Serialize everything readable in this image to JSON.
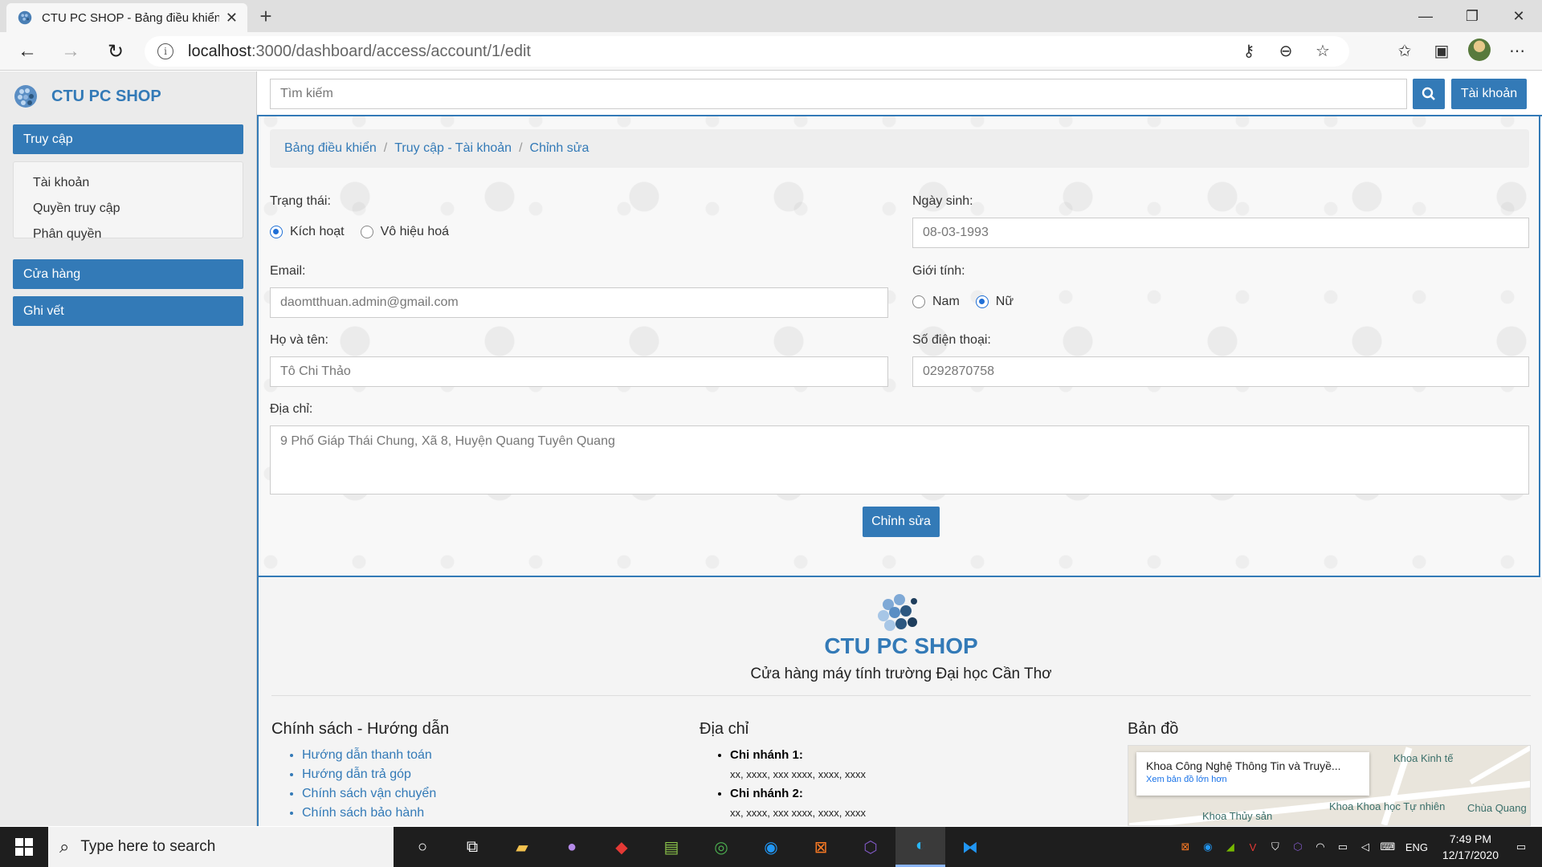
{
  "browser": {
    "tab_title": "CTU PC SHOP - Bảng điều khiển",
    "tab_close": "✕",
    "new_tab": "+",
    "url_host": "localhost",
    "url_path": ":3000/dashboard/access/account/1/edit",
    "window_controls": {
      "minimize": "—",
      "maximize": "❐",
      "close": "✕"
    }
  },
  "sidebar": {
    "brand": "CTU PC SHOP",
    "sections": [
      {
        "label": "Truy cập"
      },
      {
        "label": "Cửa hàng"
      },
      {
        "label": "Ghi vết"
      }
    ],
    "access_items": [
      "Tài khoản",
      "Quyền truy cập",
      "Phân quyền"
    ]
  },
  "topbar": {
    "search_placeholder": "Tìm kiếm",
    "account_button": "Tài khoản"
  },
  "breadcrumb": [
    "Bảng điều khiển",
    "Truy cập - Tài khoản",
    "Chỉnh sửa"
  ],
  "form": {
    "status_label": "Trạng thái:",
    "status_options": [
      "Kích hoạt",
      "Vô hiệu hoá"
    ],
    "status_selected": "Kích hoạt",
    "birthday_label": "Ngày sinh:",
    "birthday_value": "08-03-1993",
    "email_label": "Email:",
    "email_value": "daomtthuan.admin@gmail.com",
    "gender_label": "Giới tính:",
    "gender_options": [
      "Nam",
      "Nữ"
    ],
    "gender_selected": "Nữ",
    "fullname_label": "Họ và tên:",
    "fullname_value": "Tô Chi Thảo",
    "phone_label": "Số điện thoại:",
    "phone_value": "0292870758",
    "address_label": "Địa chỉ:",
    "address_value": "9 Phố Giáp Thái Chung, Xã 8, Huyện Quang Tuyên Quang",
    "submit": "Chỉnh sửa"
  },
  "footer": {
    "brand": "CTU PC SHOP",
    "tagline": "Cửa hàng máy tính trường Đại học Cần Thơ",
    "policy_heading": "Chính sách - Hướng dẫn",
    "policy_links": [
      "Hướng dẫn thanh toán",
      "Hướng dẫn trả góp",
      "Chính sách vận chuyển",
      "Chính sách bảo hành"
    ],
    "address_heading": "Địa chỉ",
    "branches": [
      {
        "name": "Chi nhánh 1:",
        "address": "xx, xxxx, xxx xxxx, xxxx, xxxx"
      },
      {
        "name": "Chi nhánh 2:",
        "address": "xx, xxxx, xxx xxxx, xxxx, xxxx"
      }
    ],
    "map_heading": "Bản đồ",
    "map_card_title": "Khoa Công Nghệ Thông Tin và Truyề...",
    "map_card_link": "Xem bản đồ lớn hơn",
    "map_labels": [
      "Khoa Kinh tế",
      "Khoa Khoa học Tự nhiên",
      "Khoa Thủy sản",
      "Chùa Quang"
    ]
  },
  "taskbar": {
    "search_placeholder": "Type here to search",
    "language": "ENG",
    "time": "7:49 PM",
    "date": "12/17/2020"
  },
  "colors": {
    "primary": "#337ab7",
    "taskbar": "#1e1e1e",
    "sidebar": "#ebebeb"
  }
}
